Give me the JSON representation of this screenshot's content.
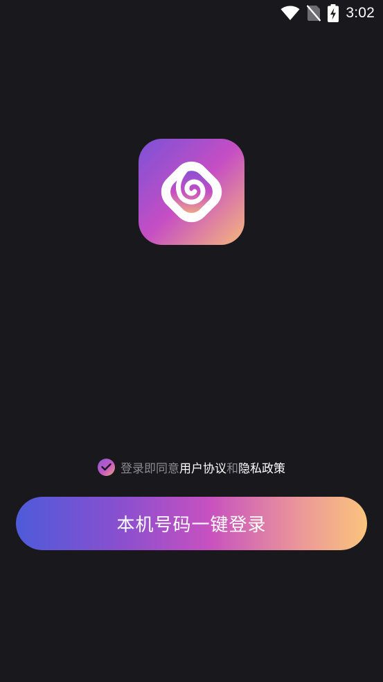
{
  "status_bar": {
    "time": "3:02",
    "icons": [
      "wifi-icon",
      "no-sim-icon",
      "battery-charging-icon"
    ]
  },
  "logo": {
    "icon": "app-logo-icon",
    "gradient": [
      "#7b52d6",
      "#c54ec4",
      "#f6b87c"
    ]
  },
  "agreement": {
    "checked": true,
    "prefix": "登录即同意",
    "user_agreement": "用户协议",
    "conjunction": "和",
    "privacy_policy": "隐私政策"
  },
  "login": {
    "button_label": "本机号码一键登录",
    "gradient": [
      "#4e5bd9",
      "#c751c0",
      "#fac47d"
    ]
  },
  "colors": {
    "background": "#19181c",
    "muted_text": "#8b8a92",
    "text": "#ffffff"
  }
}
